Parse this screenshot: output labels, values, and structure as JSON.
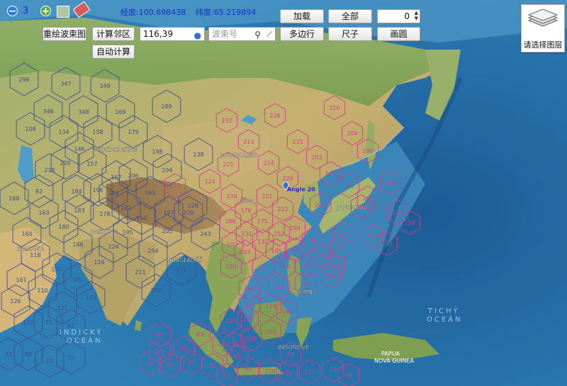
{
  "toolbar": {
    "zoom_level": "3",
    "longitude_label": "经度:100.698438",
    "latitude_label": "纬度:65.219894",
    "redraw_label": "重绘波束图",
    "calc_neighbor_label": "计算邻区",
    "auto_calc_label": "自动计算",
    "coord_input_value": "116,39",
    "beam_input_placeholder": "波束号",
    "load_label": "加载",
    "all_label": "全部",
    "polygon_label": "多边行",
    "ruler_label": "尺子",
    "circle_label": "画圆",
    "spinner_value": "0"
  },
  "layer_panel": {
    "label": "请选择图层"
  },
  "map_labels": {
    "places": [
      "MONGOLSKO",
      "ČÍNA",
      "KAZACHSTAN",
      "PAKISTAN",
      "JAPONSKO",
      "FILIPÍNY",
      "INDONÉSIE",
      "PAPUA",
      "NOVÁ GUINEA",
      "INDICKÝ",
      "OCEÁN",
      "TICHÝ",
      "OCEÁN",
      "SAUDSKÁ",
      "BANGLADÉŠ",
      "Angle 20"
    ]
  },
  "beam_cells": {
    "pink": [
      "232",
      "226",
      "216",
      "215",
      "213",
      "225",
      "214",
      "204",
      "224",
      "223",
      "203",
      "229",
      "202",
      "190",
      "221",
      "201",
      "191",
      "182",
      "176",
      "176",
      "212",
      "200",
      "188",
      "175",
      "199",
      "187",
      "174",
      "177",
      "131",
      "152",
      "186",
      "173",
      "159",
      "158",
      "153",
      "147",
      "132",
      "185",
      "171",
      "172",
      "157",
      "150",
      "117",
      "170",
      "156",
      "135",
      "149",
      "113",
      "159",
      "155",
      "154",
      "140",
      "139",
      "114",
      "148",
      "130",
      "146",
      "103",
      "109",
      "89",
      "97",
      "95",
      "85",
      "83",
      "119",
      "118",
      "117",
      "33",
      "36",
      "34",
      "35",
      "37",
      "38",
      "39",
      "49",
      "64"
    ],
    "blue": [
      "296",
      "347",
      "349",
      "189",
      "346",
      "348",
      "169",
      "108",
      "134",
      "158",
      "179",
      "146",
      "157",
      "167",
      "198",
      "209",
      "138",
      "218",
      "194",
      "206",
      "193",
      "184",
      "165",
      "196",
      "181",
      "164",
      "183",
      "178",
      "180",
      "195",
      "163",
      "160",
      "205",
      "204",
      "166",
      "224",
      "211",
      "207",
      "220",
      "231",
      "228",
      "243",
      "197",
      "118",
      "151",
      "110",
      "161",
      "191",
      "116",
      "168",
      "82",
      "123",
      "121",
      "126",
      "112",
      "73",
      "92",
      "71",
      "80",
      "67",
      "79"
    ]
  },
  "colors": {
    "ocean": "#2d74a8",
    "land": "#b5a262",
    "pink_hex": "#d83b8a",
    "blue_hex": "#3c4f93",
    "text_blue": "#1733c8"
  }
}
